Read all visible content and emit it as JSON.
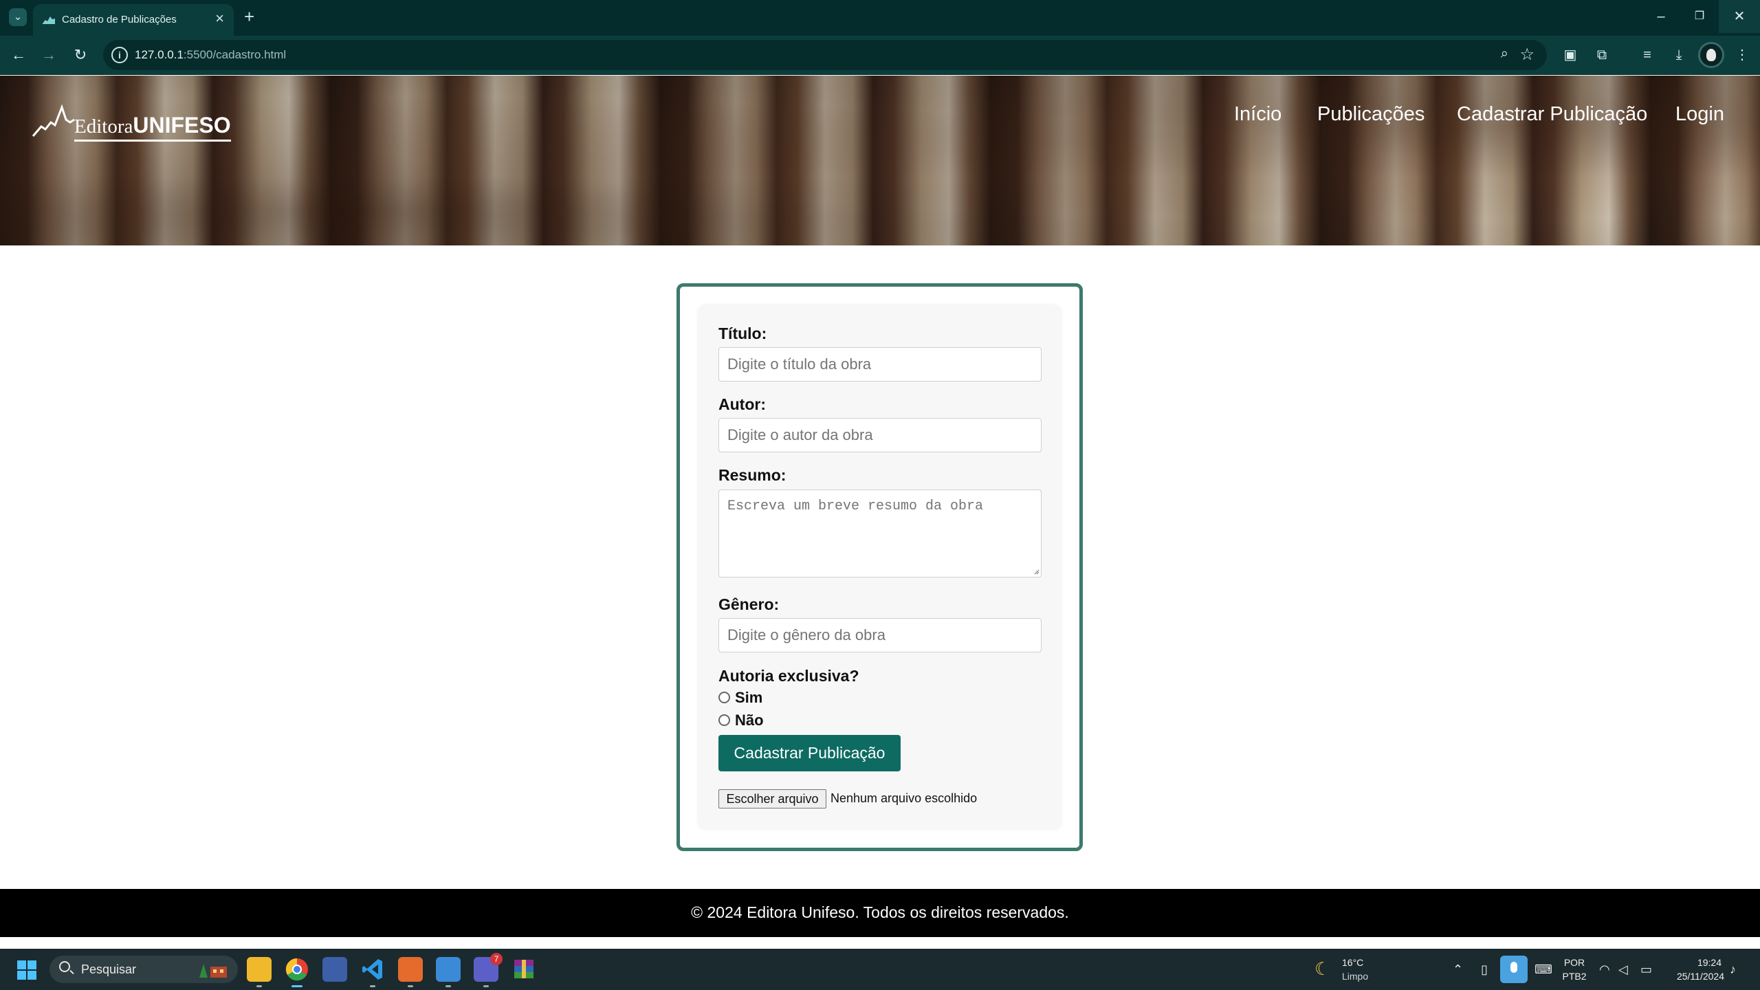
{
  "browser": {
    "tab_title": "Cadastro de Publicações",
    "url_host": "127.0.0.1",
    "url_path": ":5500/cadastro.html"
  },
  "header": {
    "logo_light": "Editora",
    "logo_bold": "UNIFESO",
    "nav": [
      "Início",
      "Publicações",
      "Cadastrar Publicação",
      "Login"
    ]
  },
  "form": {
    "title_label": "Título:",
    "title_placeholder": "Digite o título da obra",
    "author_label": "Autor:",
    "author_placeholder": "Digite o autor da obra",
    "summary_label": "Resumo:",
    "summary_placeholder": "Escreva um breve resumo da obra",
    "genre_label": "Gênero:",
    "genre_placeholder": "Digite o gênero da obra",
    "exclusive_label": "Autoria exclusiva?",
    "option_yes": "Sim",
    "option_no": "Não",
    "submit_label": "Cadastrar Publicação",
    "file_button": "Escolher arquivo",
    "file_status": "Nenhum arquivo escolhido"
  },
  "footer": {
    "text": "© 2024 Editora Unifeso. Todos os direitos reservados."
  },
  "taskbar": {
    "search_placeholder": "Pesquisar",
    "weather_temp": "16°C",
    "weather_desc": "Limpo",
    "lang_top": "POR",
    "lang_bottom": "PTB2",
    "time": "19:24",
    "date": "25/11/2024",
    "teams_badge": "7"
  },
  "colors": {
    "brand_green": "#0d6b62",
    "form_border": "#3d7a6c",
    "chrome_bg": "#042c2c"
  }
}
